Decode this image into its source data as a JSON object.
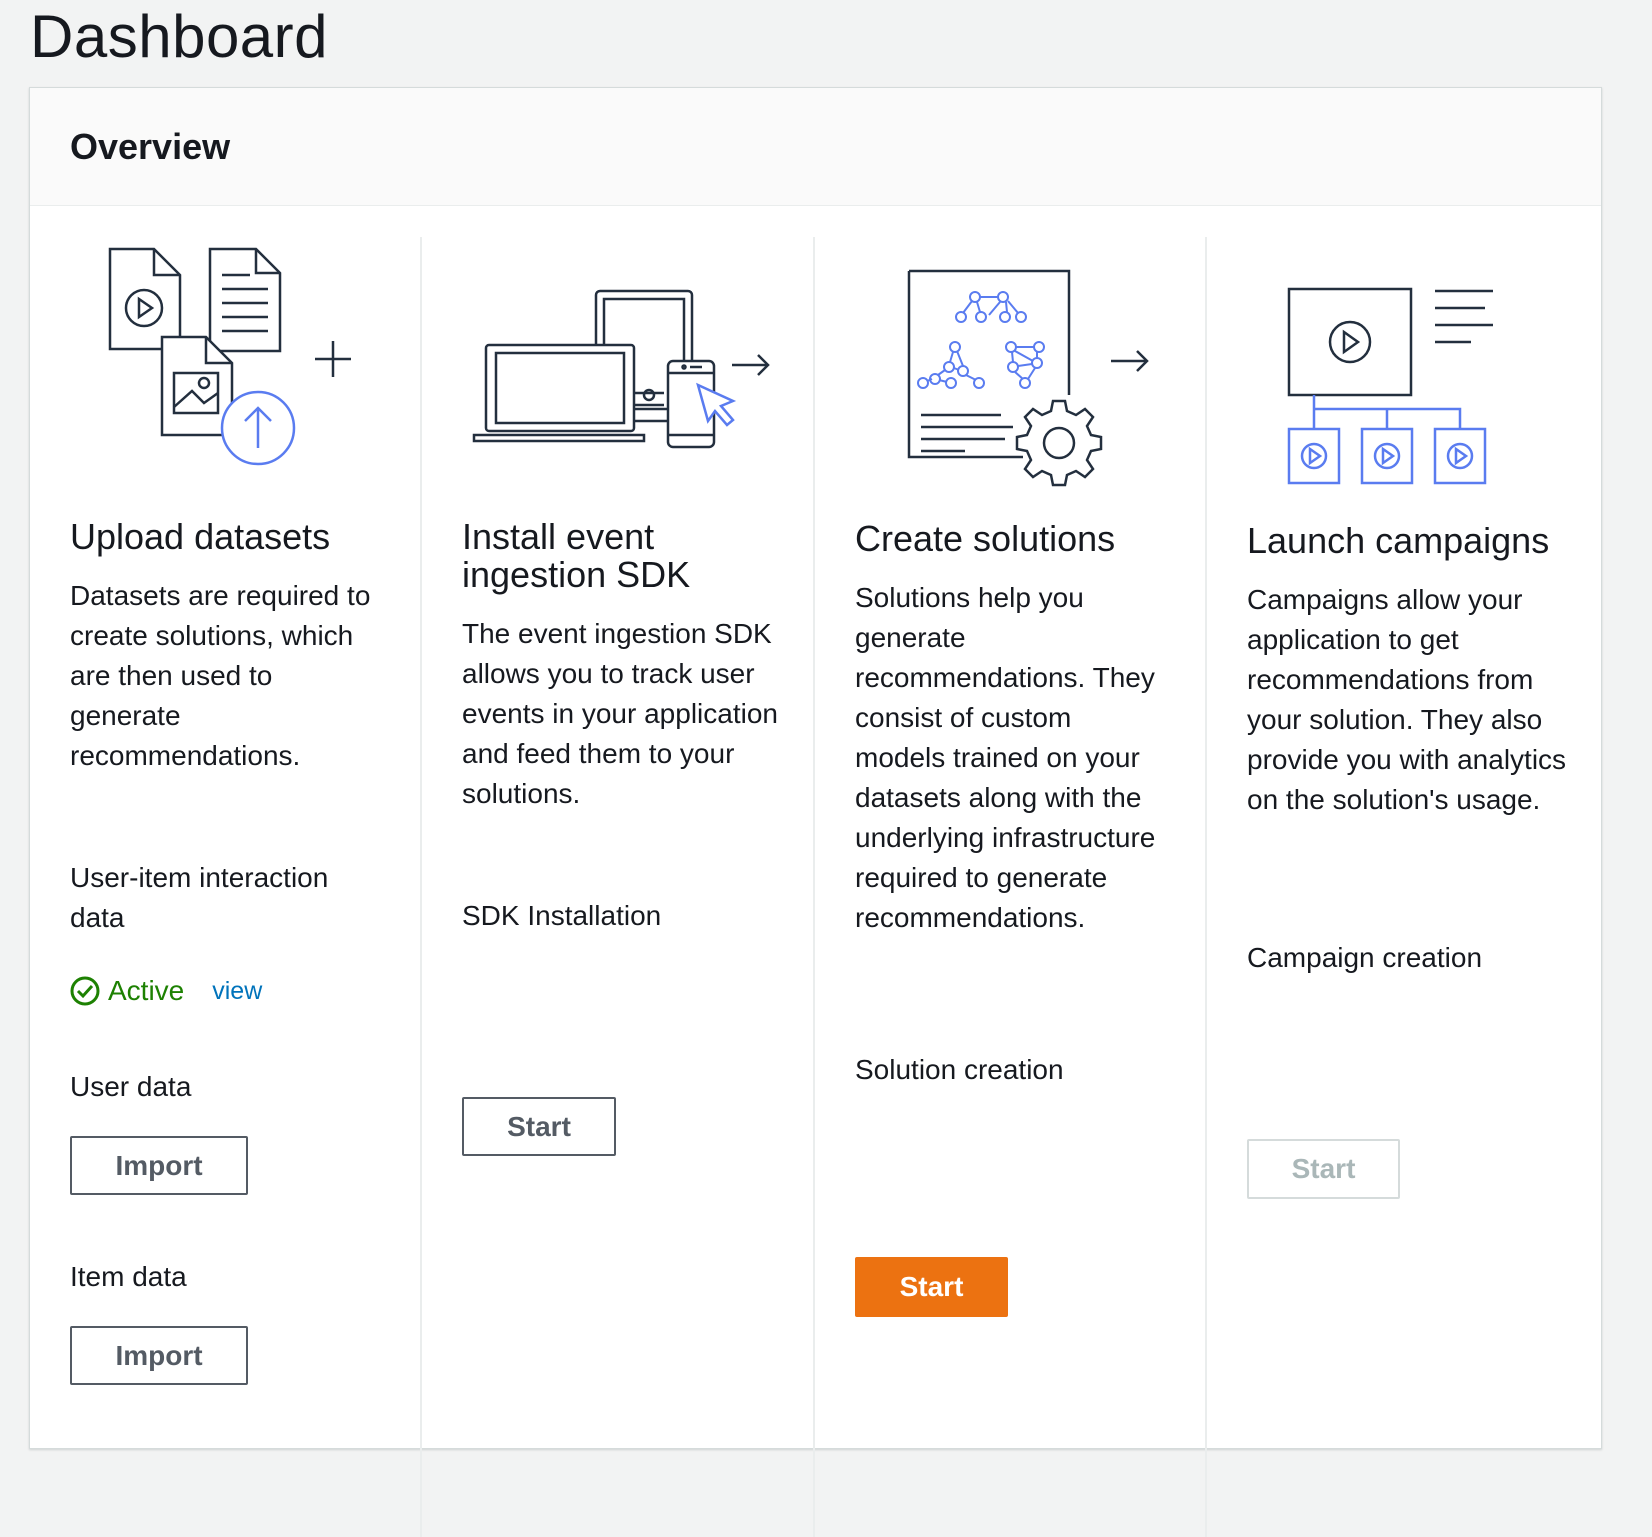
{
  "page": {
    "title": "Dashboard"
  },
  "overview": {
    "title": "Overview",
    "columns": [
      {
        "illustration": "upload-datasets-illustration",
        "title": "Upload datasets",
        "description": "Datasets are required to create solutions, which are then used to generate recommendations.",
        "items": [
          {
            "label": "User-item interaction data",
            "status": "Active",
            "status_link": "view"
          },
          {
            "label": "User data",
            "button": "Import"
          },
          {
            "label": "Item data",
            "button": "Import"
          }
        ]
      },
      {
        "illustration": "install-sdk-illustration",
        "title": "Install event ingestion SDK",
        "description": "The event ingestion SDK allows you to track user events in your application and feed them to your solutions.",
        "items": [
          {
            "label": "SDK Installation",
            "button": "Start"
          }
        ]
      },
      {
        "illustration": "create-solutions-illustration",
        "title": "Create solutions",
        "description": "Solutions help you generate recommendations. They consist of custom models trained on your datasets along with the underlying infrastructure required to generate recommendations.",
        "items": [
          {
            "label": "Solution creation",
            "button": "Start",
            "button_style": "primary"
          }
        ]
      },
      {
        "illustration": "launch-campaigns-illustration",
        "title": "Launch campaigns",
        "description": "Campaigns allow your application to get recommendations from your solution. They also provide you with analytics on the solution's usage.",
        "items": [
          {
            "label": "Campaign creation",
            "button": "Start",
            "button_style": "disabled"
          }
        ]
      }
    ]
  },
  "colors": {
    "accent_blue": "#5a7cf0",
    "primary_button": "#ec7211",
    "success": "#1d8102",
    "link": "#0073bb"
  }
}
